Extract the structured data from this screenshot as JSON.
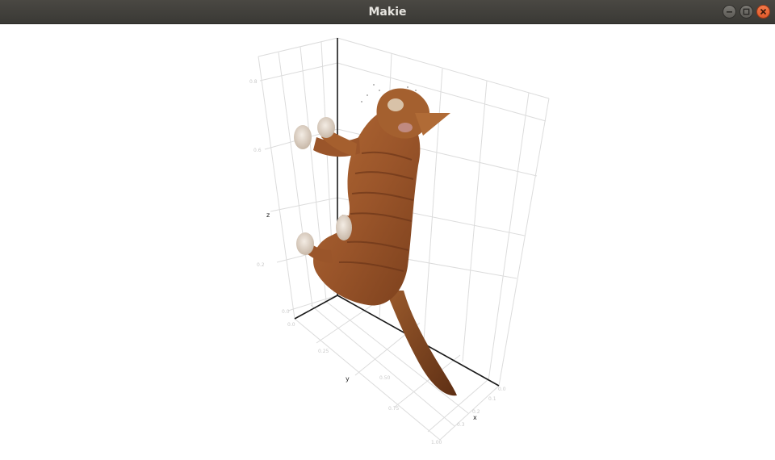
{
  "window": {
    "title": "Makie"
  },
  "icons": {
    "minimize": "minimize-icon",
    "maximize": "maximize-icon",
    "close": "close-icon"
  },
  "axes": {
    "xlabel": "x",
    "ylabel": "y",
    "zlabel": "z"
  },
  "colors": {
    "titlebar": "#3e3d39",
    "close_button": "#e8602f",
    "grid": "#d8d8d8",
    "axis_frame": "#1a1a1a",
    "fur": "#9a552a"
  }
}
